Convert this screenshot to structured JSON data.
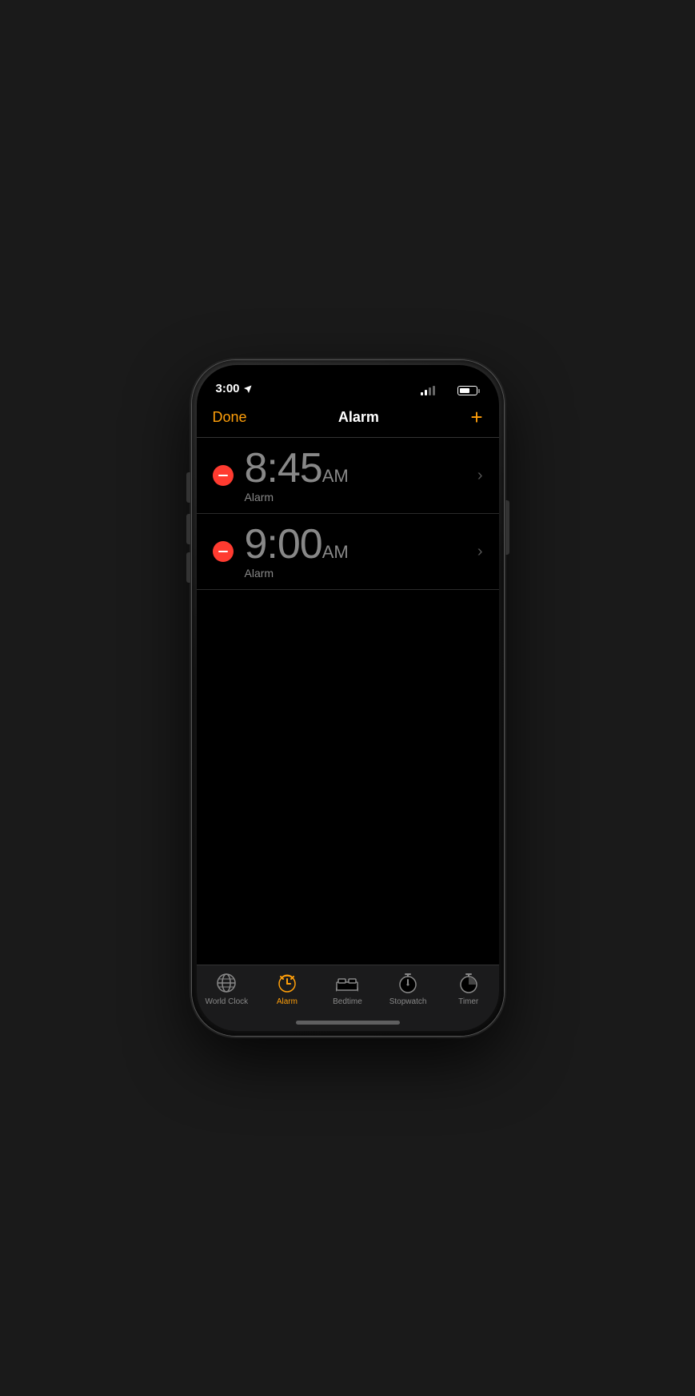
{
  "status_bar": {
    "time": "3:00",
    "location_icon": "location-arrow"
  },
  "header": {
    "done_label": "Done",
    "title": "Alarm",
    "add_label": "+"
  },
  "alarms": [
    {
      "time": "8:45",
      "ampm": "AM",
      "label": "Alarm"
    },
    {
      "time": "9:00",
      "ampm": "AM",
      "label": "Alarm"
    }
  ],
  "tabs": [
    {
      "id": "world-clock",
      "label": "World Clock",
      "active": false
    },
    {
      "id": "alarm",
      "label": "Alarm",
      "active": true
    },
    {
      "id": "bedtime",
      "label": "Bedtime",
      "active": false
    },
    {
      "id": "stopwatch",
      "label": "Stopwatch",
      "active": false
    },
    {
      "id": "timer",
      "label": "Timer",
      "active": false
    }
  ]
}
